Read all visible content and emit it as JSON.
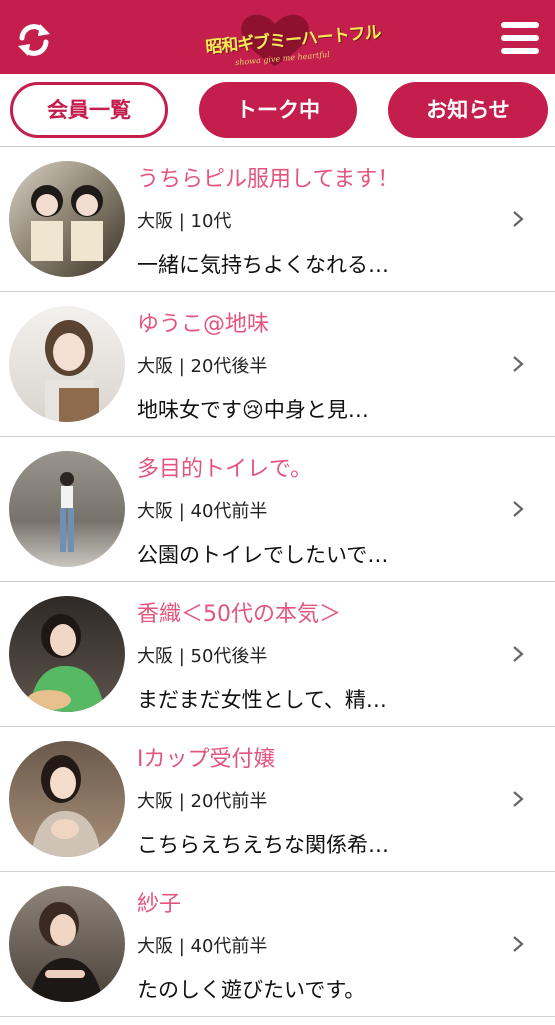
{
  "header": {
    "logo_title": "昭和ギブミーハートフル",
    "logo_subtitle": "showa give me heartful",
    "refresh_icon": "refresh-icon",
    "menu_icon": "hamburger-menu-icon",
    "brand_color": "#c41e4d"
  },
  "tabs": [
    {
      "label": "会員一覧",
      "active": false
    },
    {
      "label": "トーク中",
      "active": true
    },
    {
      "label": "お知らせ",
      "active": true
    }
  ],
  "members": [
    {
      "name": "うちらピル服用してます！",
      "meta": "大阪 | 10代",
      "message": "一緒に気持ちよくなれる…"
    },
    {
      "name": "ゆうこ@地味",
      "meta": "大阪 | 20代後半",
      "message": "地味女です😢中身と見…"
    },
    {
      "name": "多目的トイレで。",
      "meta": "大阪 | 40代前半",
      "message": "公園のトイレでしたいで…"
    },
    {
      "name": "香織＜50代の本気＞",
      "meta": "大阪 | 50代後半",
      "message": "まだまだ女性として、精…"
    },
    {
      "name": "Iカップ受付嬢",
      "meta": "大阪 | 20代前半",
      "message": "こちらえちえちな関係希…"
    },
    {
      "name": "紗子",
      "meta": "大阪 | 40代前半",
      "message": "たのしく遊びたいです。"
    }
  ]
}
